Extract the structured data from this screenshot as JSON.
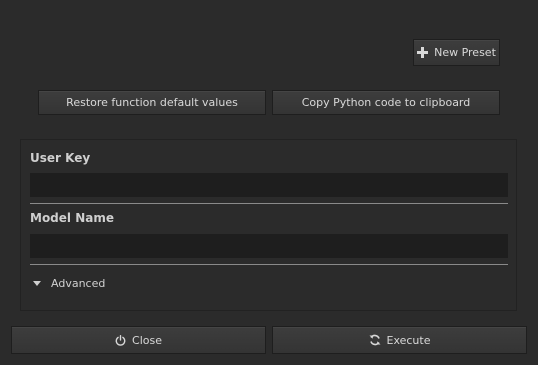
{
  "toolbar": {
    "new_preset_label": "New Preset",
    "new_preset_icon": "plus-icon"
  },
  "actions": {
    "restore_label": "Restore function default values",
    "copy_label": "Copy Python code to clipboard"
  },
  "form": {
    "user_key": {
      "label": "User Key",
      "value": ""
    },
    "model_name": {
      "label": "Model Name",
      "value": ""
    },
    "advanced_label": "Advanced",
    "advanced_icon": "triangle-down-icon"
  },
  "footer": {
    "close_label": "Close",
    "close_icon": "power-icon",
    "execute_label": "Execute",
    "execute_icon": "refresh-icon"
  },
  "colors": {
    "background": "#2b2b2b",
    "input_background": "#1e1e1e",
    "button_background": "#3a3a3a",
    "text": "#d6d6d6"
  }
}
